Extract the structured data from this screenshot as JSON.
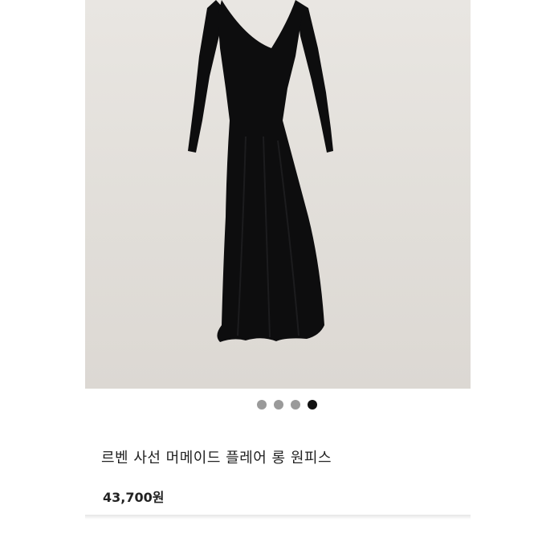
{
  "product": {
    "image_alt": "black long flare dress on hanger",
    "title": "르벤 사선 머메이드 플레어 롱 원피스",
    "price": "43,700원"
  },
  "carousel": {
    "count": 4,
    "active_index": 3
  },
  "colors": {
    "dress": "#0d0d0e",
    "wall": "#e4e1dc",
    "dot_inactive": "#9a9a9a",
    "dot_active": "#111111"
  }
}
